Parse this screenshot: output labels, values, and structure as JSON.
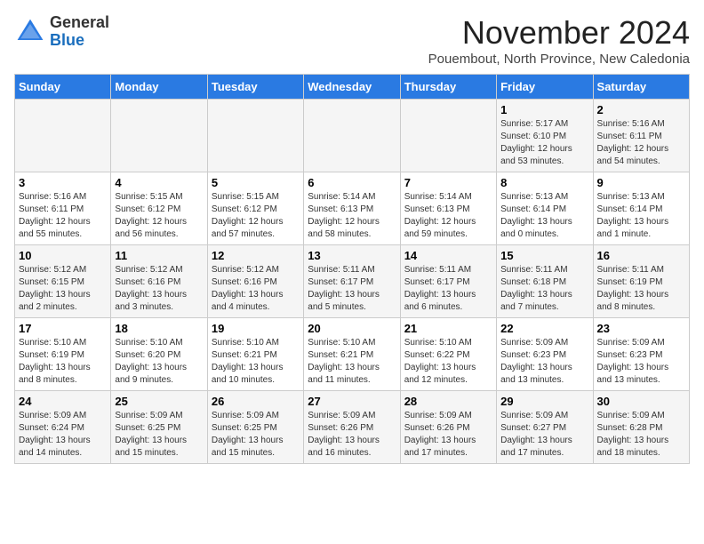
{
  "header": {
    "logo_general": "General",
    "logo_blue": "Blue",
    "title": "November 2024",
    "subtitle": "Pouembout, North Province, New Caledonia"
  },
  "weekdays": [
    "Sunday",
    "Monday",
    "Tuesday",
    "Wednesday",
    "Thursday",
    "Friday",
    "Saturday"
  ],
  "weeks": [
    [
      {
        "day": "",
        "info": ""
      },
      {
        "day": "",
        "info": ""
      },
      {
        "day": "",
        "info": ""
      },
      {
        "day": "",
        "info": ""
      },
      {
        "day": "",
        "info": ""
      },
      {
        "day": "1",
        "info": "Sunrise: 5:17 AM\nSunset: 6:10 PM\nDaylight: 12 hours\nand 53 minutes."
      },
      {
        "day": "2",
        "info": "Sunrise: 5:16 AM\nSunset: 6:11 PM\nDaylight: 12 hours\nand 54 minutes."
      }
    ],
    [
      {
        "day": "3",
        "info": "Sunrise: 5:16 AM\nSunset: 6:11 PM\nDaylight: 12 hours\nand 55 minutes."
      },
      {
        "day": "4",
        "info": "Sunrise: 5:15 AM\nSunset: 6:12 PM\nDaylight: 12 hours\nand 56 minutes."
      },
      {
        "day": "5",
        "info": "Sunrise: 5:15 AM\nSunset: 6:12 PM\nDaylight: 12 hours\nand 57 minutes."
      },
      {
        "day": "6",
        "info": "Sunrise: 5:14 AM\nSunset: 6:13 PM\nDaylight: 12 hours\nand 58 minutes."
      },
      {
        "day": "7",
        "info": "Sunrise: 5:14 AM\nSunset: 6:13 PM\nDaylight: 12 hours\nand 59 minutes."
      },
      {
        "day": "8",
        "info": "Sunrise: 5:13 AM\nSunset: 6:14 PM\nDaylight: 13 hours\nand 0 minutes."
      },
      {
        "day": "9",
        "info": "Sunrise: 5:13 AM\nSunset: 6:14 PM\nDaylight: 13 hours\nand 1 minute."
      }
    ],
    [
      {
        "day": "10",
        "info": "Sunrise: 5:12 AM\nSunset: 6:15 PM\nDaylight: 13 hours\nand 2 minutes."
      },
      {
        "day": "11",
        "info": "Sunrise: 5:12 AM\nSunset: 6:16 PM\nDaylight: 13 hours\nand 3 minutes."
      },
      {
        "day": "12",
        "info": "Sunrise: 5:12 AM\nSunset: 6:16 PM\nDaylight: 13 hours\nand 4 minutes."
      },
      {
        "day": "13",
        "info": "Sunrise: 5:11 AM\nSunset: 6:17 PM\nDaylight: 13 hours\nand 5 minutes."
      },
      {
        "day": "14",
        "info": "Sunrise: 5:11 AM\nSunset: 6:17 PM\nDaylight: 13 hours\nand 6 minutes."
      },
      {
        "day": "15",
        "info": "Sunrise: 5:11 AM\nSunset: 6:18 PM\nDaylight: 13 hours\nand 7 minutes."
      },
      {
        "day": "16",
        "info": "Sunrise: 5:11 AM\nSunset: 6:19 PM\nDaylight: 13 hours\nand 8 minutes."
      }
    ],
    [
      {
        "day": "17",
        "info": "Sunrise: 5:10 AM\nSunset: 6:19 PM\nDaylight: 13 hours\nand 8 minutes."
      },
      {
        "day": "18",
        "info": "Sunrise: 5:10 AM\nSunset: 6:20 PM\nDaylight: 13 hours\nand 9 minutes."
      },
      {
        "day": "19",
        "info": "Sunrise: 5:10 AM\nSunset: 6:21 PM\nDaylight: 13 hours\nand 10 minutes."
      },
      {
        "day": "20",
        "info": "Sunrise: 5:10 AM\nSunset: 6:21 PM\nDaylight: 13 hours\nand 11 minutes."
      },
      {
        "day": "21",
        "info": "Sunrise: 5:10 AM\nSunset: 6:22 PM\nDaylight: 13 hours\nand 12 minutes."
      },
      {
        "day": "22",
        "info": "Sunrise: 5:09 AM\nSunset: 6:23 PM\nDaylight: 13 hours\nand 13 minutes."
      },
      {
        "day": "23",
        "info": "Sunrise: 5:09 AM\nSunset: 6:23 PM\nDaylight: 13 hours\nand 13 minutes."
      }
    ],
    [
      {
        "day": "24",
        "info": "Sunrise: 5:09 AM\nSunset: 6:24 PM\nDaylight: 13 hours\nand 14 minutes."
      },
      {
        "day": "25",
        "info": "Sunrise: 5:09 AM\nSunset: 6:25 PM\nDaylight: 13 hours\nand 15 minutes."
      },
      {
        "day": "26",
        "info": "Sunrise: 5:09 AM\nSunset: 6:25 PM\nDaylight: 13 hours\nand 15 minutes."
      },
      {
        "day": "27",
        "info": "Sunrise: 5:09 AM\nSunset: 6:26 PM\nDaylight: 13 hours\nand 16 minutes."
      },
      {
        "day": "28",
        "info": "Sunrise: 5:09 AM\nSunset: 6:26 PM\nDaylight: 13 hours\nand 17 minutes."
      },
      {
        "day": "29",
        "info": "Sunrise: 5:09 AM\nSunset: 6:27 PM\nDaylight: 13 hours\nand 17 minutes."
      },
      {
        "day": "30",
        "info": "Sunrise: 5:09 AM\nSunset: 6:28 PM\nDaylight: 13 hours\nand 18 minutes."
      }
    ]
  ]
}
